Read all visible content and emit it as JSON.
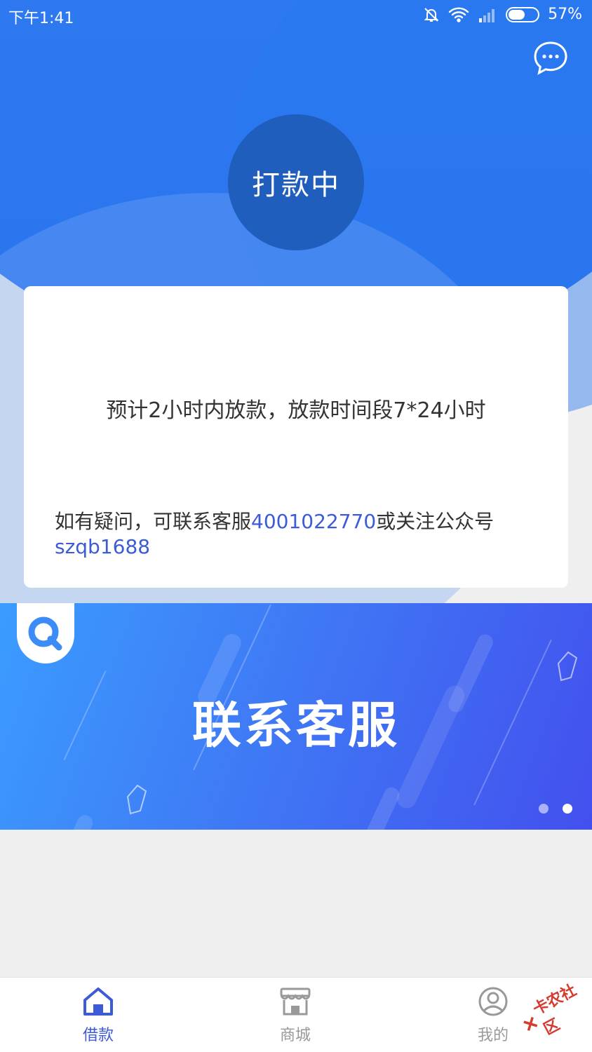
{
  "status_bar": {
    "time": "下午1:41",
    "battery": "57%",
    "battery_level": 0.57,
    "icons": [
      "bell-off-icon",
      "wifi-icon",
      "signal-icon",
      "battery-icon"
    ]
  },
  "header": {
    "chat_icon": "chat-bubble-icon",
    "status_label": "打款中"
  },
  "card": {
    "main_text": "预计2小时内放款，放款时间段7*24小时",
    "help_prefix": "如有疑问，可联系客服",
    "phone": "4001022770",
    "help_middle": "或关注公众号",
    "wechat_id": "szqb1688"
  },
  "banner": {
    "title": "联系客服",
    "logo_icon": "search-logo-icon",
    "slide_count": 2,
    "active_slide": 2
  },
  "bottom_nav": {
    "items": [
      {
        "label": "借款",
        "icon": "home-icon",
        "active": true
      },
      {
        "label": "商城",
        "icon": "store-icon",
        "active": false
      },
      {
        "label": "我的",
        "icon": "user-icon",
        "active": false
      }
    ]
  },
  "watermark": {
    "text": "卡农社区"
  },
  "colors": {
    "primary_blue": "#2f7bf0",
    "status_circle": "#1f5ebd",
    "link": "#3d5bd6",
    "nav_inactive": "#999999"
  }
}
